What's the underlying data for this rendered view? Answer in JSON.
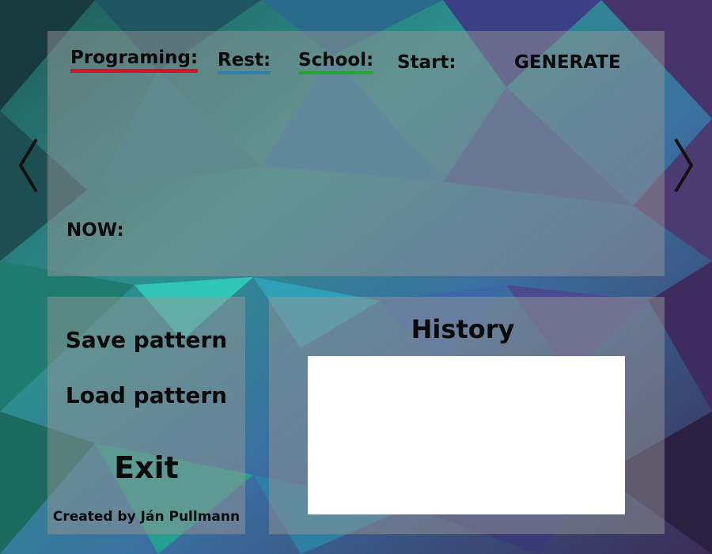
{
  "top_panel": {
    "tabs": [
      {
        "label": "Programing:",
        "underline_color": "#d7132c"
      },
      {
        "label": "Rest:",
        "underline_color": "#2f7fb0"
      },
      {
        "label": "School:",
        "underline_color": "#22a534"
      }
    ],
    "start_label": "Start:",
    "generate_label": "GENERATE",
    "now_label": "NOW:"
  },
  "navigation": {
    "prev_icon": "chevron-left-icon",
    "next_icon": "chevron-right-icon"
  },
  "menu": {
    "save_pattern": "Save pattern",
    "load_pattern": "Load pattern",
    "exit": "Exit",
    "credits": "Created by Ján Pullmann"
  },
  "history": {
    "title": "History",
    "items": []
  },
  "colors": {
    "panel_overlay": "#969696",
    "text": "#0a0a0a",
    "history_list_bg": "#ffffff"
  }
}
